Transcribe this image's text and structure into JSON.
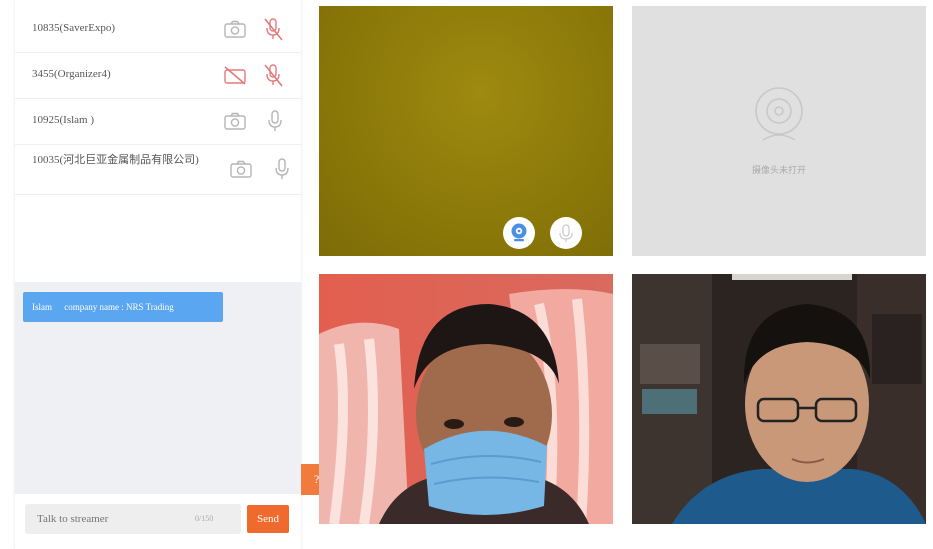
{
  "participants": [
    {
      "name": "10835(SaverExpo)",
      "camera": "on",
      "mic": "muted"
    },
    {
      "name": "3455(Organizer4)",
      "camera": "off",
      "mic": "muted"
    },
    {
      "name": "10925(Islam )",
      "camera": "on",
      "mic": "on"
    },
    {
      "name": "10035(河北巨亚金属制品有限公司)",
      "camera": "on",
      "mic": "on"
    }
  ],
  "chat": {
    "messages": [
      {
        "user": "Islam",
        "text": "company name : NRS Trading"
      }
    ],
    "input_placeholder": "Talk to streamer",
    "char_count": "0/150",
    "send_label": "Send"
  },
  "collapse_label": "?",
  "videos": [
    {
      "id": "tile-1",
      "type": "live",
      "controls": [
        "camera-icon",
        "microphone-icon"
      ]
    },
    {
      "id": "tile-2",
      "type": "camera-off",
      "placeholder_text": "摄像头未打开"
    },
    {
      "id": "tile-3",
      "type": "live"
    },
    {
      "id": "tile-4",
      "type": "live"
    }
  ],
  "colors": {
    "accent_orange": "#f0692d",
    "message_blue": "#5aa6f1",
    "muted_red": "#e07b7b",
    "icon_gray": "#b5b5b5",
    "control_blue": "#4a90e2"
  }
}
